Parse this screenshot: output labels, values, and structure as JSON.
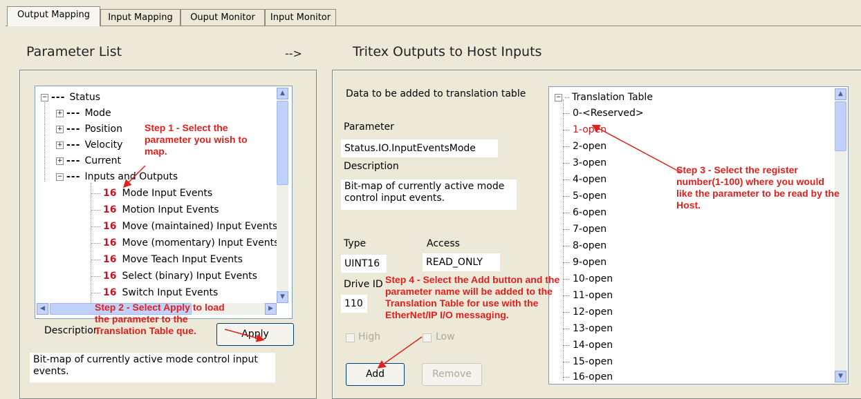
{
  "tabs": [
    {
      "label": "Output Mapping",
      "active": true
    },
    {
      "label": "Input Mapping",
      "active": false
    },
    {
      "label": "Ouput Monitor",
      "active": false
    },
    {
      "label": "Input Monitor",
      "active": false
    }
  ],
  "headers": {
    "param_list": "Parameter List",
    "arrow": "-->",
    "outputs": "Tritex Outputs to Host Inputs"
  },
  "tree": {
    "status": "Status",
    "mode": "Mode",
    "position": "Position",
    "velocity": "Velocity",
    "current": "Current",
    "inputs_outputs": "Inputs and Outputs",
    "events": [
      {
        "num": "16",
        "label": "Mode Input Events"
      },
      {
        "num": "16",
        "label": "Motion Input Events"
      },
      {
        "num": "16",
        "label": "Move (maintained) Input Events"
      },
      {
        "num": "16",
        "label": "Move (momentary) Input Events"
      },
      {
        "num": "16",
        "label": "Move Teach Input Events"
      },
      {
        "num": "16",
        "label": "Select (binary) Input Events"
      },
      {
        "num": "16",
        "label": "Switch Input Events"
      }
    ]
  },
  "left": {
    "description_label": "Description",
    "apply_label": "Apply",
    "description_text": "Bit-map of currently active mode control input events."
  },
  "detail": {
    "heading": "Data to be added to translation table",
    "parameter_label": "Parameter",
    "parameter_value": "Status.IO.InputEventsMode",
    "description_label": "Description",
    "description_value": "Bit-map of currently active mode control input events.",
    "type_label": "Type",
    "type_value": "UINT16",
    "access_label": "Access",
    "access_value": "READ_ONLY",
    "drive_id_label": "Drive ID",
    "drive_id_value": "110",
    "high_label": "High",
    "low_label": "Low",
    "add_label": "Add",
    "remove_label": "Remove"
  },
  "translation": {
    "title": "Translation Table",
    "items": [
      "0-<Reserved>",
      "1-open",
      "2-open",
      "3-open",
      "4-open",
      "5-open",
      "6-open",
      "7-open",
      "8-open",
      "9-open",
      "10-open",
      "11-open",
      "12-open",
      "13-open",
      "14-open",
      "15-open",
      "16-open"
    ],
    "selected_index": 1
  },
  "notes": {
    "step1": "Step 1 - Select the parameter you wish to map.",
    "step2": "Step 2 - Select Apply to load the parameter to the Translation Table que.",
    "step3": "Step 3 - Select the register number(1-100) where you would like the parameter to be read by the Host.",
    "step4": "Step 4 - Select the Add button and the parameter name will be added to the Translation Table for use with the EtherNet/IP I/O messaging."
  },
  "colors": {
    "annotation": "#e0201c",
    "window_bg": "#ece9d8"
  }
}
